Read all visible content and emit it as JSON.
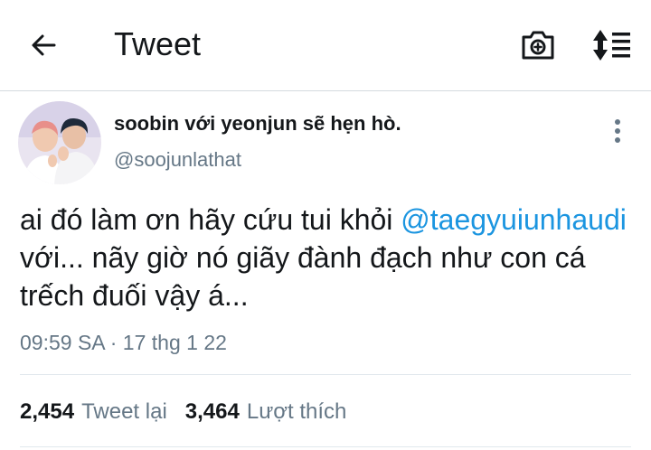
{
  "header": {
    "back_icon": "arrow-left-icon",
    "title": "Tweet",
    "camera_icon": "camera-plus-icon",
    "sort_icon": "sort-list-icon"
  },
  "tweet": {
    "author": {
      "display_name": "soobin với yeonjun sẽ hẹn hò.",
      "handle": "@soojunlathat",
      "avatar_icon": "profile-photo"
    },
    "more_icon": "more-vertical-icon",
    "text_parts": {
      "before": "ai đó làm ơn hãy cứu tui khỏi ",
      "mention": "@taegyuiunhaudi",
      "after": " với... nãy giờ nó giãy đành đạch như con cá trếch đuối vậy á..."
    },
    "timestamp": "09:59 SA · 17 thg 1 22",
    "stats": {
      "retweets_count": "2,454",
      "retweets_label": "Tweet lại",
      "likes_count": "3,464",
      "likes_label": "Lượt thích"
    }
  },
  "colors": {
    "text": "#14171a",
    "secondary": "#657786",
    "link": "#1b95e0",
    "divider": "#e1e8ed"
  }
}
